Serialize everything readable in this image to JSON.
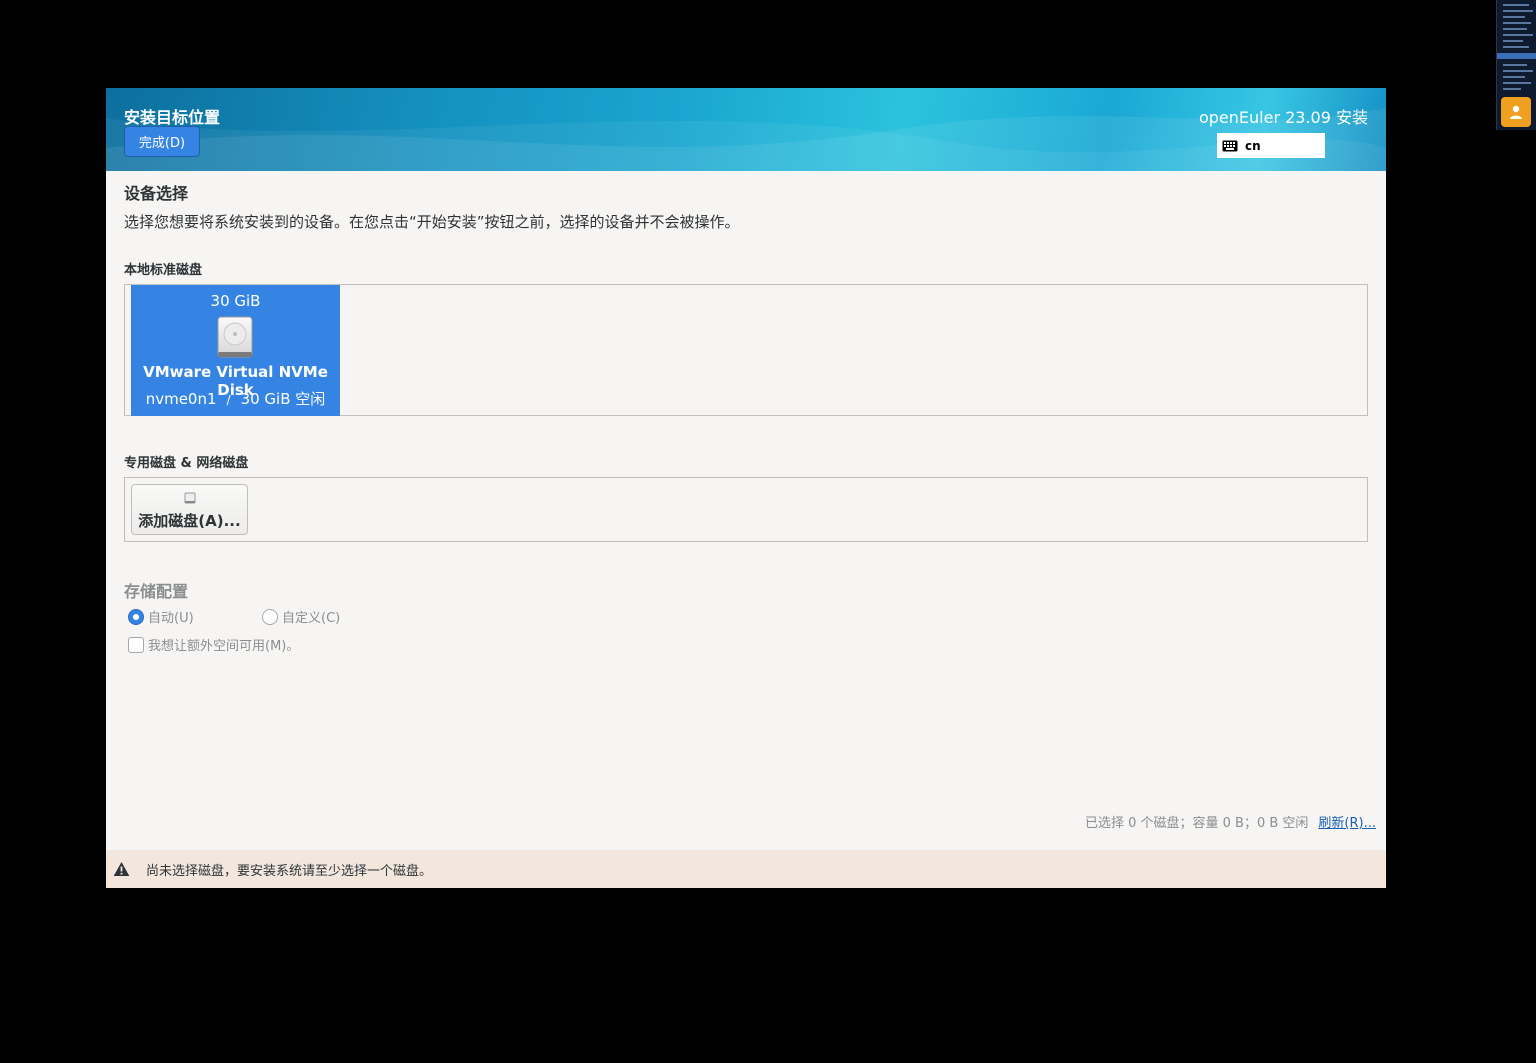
{
  "header": {
    "spoke_title": "安装目标位置",
    "done_button": "完成(D)",
    "product_title": "openEuler 23.09 安装",
    "keyboard_layout": "cn"
  },
  "device_selection": {
    "title": "设备选择",
    "description": "选择您想要将系统安装到的设备。在您点击“开始安装”按钮之前，选择的设备并不会被操作。"
  },
  "local_disks": {
    "label": "本地标准磁盘",
    "disks": [
      {
        "size": "30 GiB",
        "name": "VMware Virtual NVMe Disk",
        "device": "nvme0n1",
        "separator": "/",
        "free": "30 GiB 空闲"
      }
    ]
  },
  "special_disks": {
    "label": "专用磁盘 & 网络磁盘",
    "add_button": "添加磁盘(A)..."
  },
  "storage_config": {
    "title": "存储配置",
    "auto_label": "自动(U)",
    "custom_label": "自定义(C)",
    "selected": "auto",
    "extra_space_label": "我想让额外空间可用(M)。"
  },
  "summary": {
    "text": "已选择 0 个磁盘；容量 0 B；0 B 空闲",
    "refresh_link": "刷新(R)..."
  },
  "warning": {
    "message": "尚未选择磁盘，要安装系统请至少选择一个磁盘。"
  },
  "colors": {
    "accent": "#3584e4",
    "warning_bg": "#f3e6dd",
    "header_blue": "#1aa6d0"
  }
}
